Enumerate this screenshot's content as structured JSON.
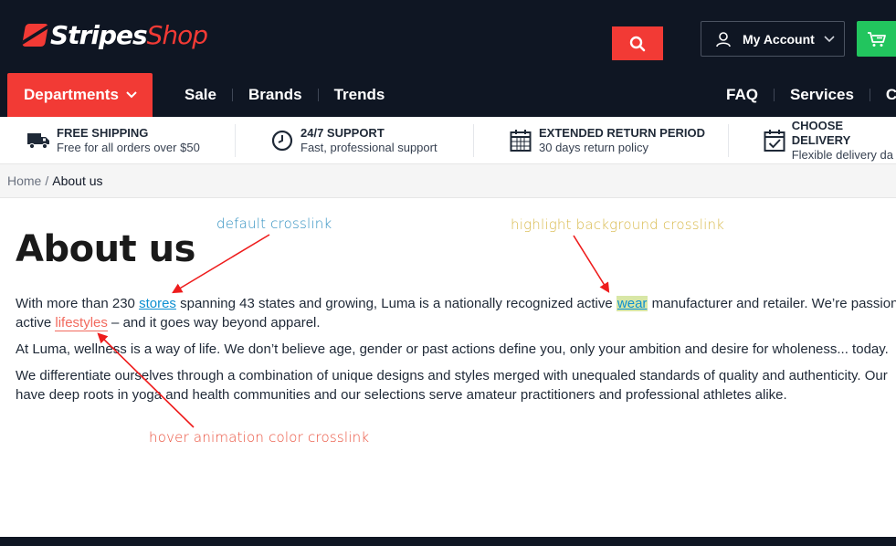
{
  "logo": {
    "part1": "Stripes",
    "part2": "Shop"
  },
  "header": {
    "account_label": "My Account",
    "departments_label": "Departments",
    "nav_left": [
      "Sale",
      "Brands",
      "Trends"
    ],
    "nav_right": [
      "FAQ",
      "Services",
      "Co"
    ]
  },
  "features": [
    {
      "icon": "truck-icon",
      "title": "FREE SHIPPING",
      "subtitle": "Free for all orders over $50"
    },
    {
      "icon": "clock-icon",
      "title": "24/7 SUPPORT",
      "subtitle": "Fast, professional support"
    },
    {
      "icon": "calendar-icon",
      "title": "EXTENDED RETURN PERIOD",
      "subtitle": "30 days return policy"
    },
    {
      "icon": "calendar-check-icon",
      "title": "CHOOSE DELIVERY",
      "subtitle": "Flexible delivery da"
    }
  ],
  "breadcrumb": {
    "home": "Home",
    "separator": "/",
    "current": "About us"
  },
  "content": {
    "title": "About us",
    "p1_a": "With more than 230 ",
    "p1_link1": "stores",
    "p1_b": " spanning 43 states and growing, Luma is a nationally recognized active ",
    "p1_link2": "wear",
    "p1_c": " manufacturer and retailer. We’re passiona",
    "p1_d": "active ",
    "p1_link3": "lifestyles",
    "p1_e": " – and it goes way beyond apparel.",
    "p2": "At Luma, wellness is a way of life. We don’t believe age, gender or past actions define you, only your ambition and desire for wholeness... today.",
    "p3_line1": "We differentiate ourselves through a combination of unique designs and styles merged with unequaled standards of quality and authenticity. Our",
    "p3_line2": "have deep roots in yoga and health communities and our selections serve amateur practitioners and professional athletes alike."
  },
  "annotations": {
    "default": "default crosslink",
    "highlight": "highlight background crosslink",
    "hover": "hover animation color crosslink"
  },
  "colors": {
    "header_bg": "#0f1623",
    "accent_red": "#f23a35",
    "cart_green": "#22c55e",
    "link_blue": "#0d8fd1",
    "highlight_bg": "#d8e7a6",
    "hover_link": "#f26a5e",
    "arrow_red": "#ee1c1c"
  }
}
